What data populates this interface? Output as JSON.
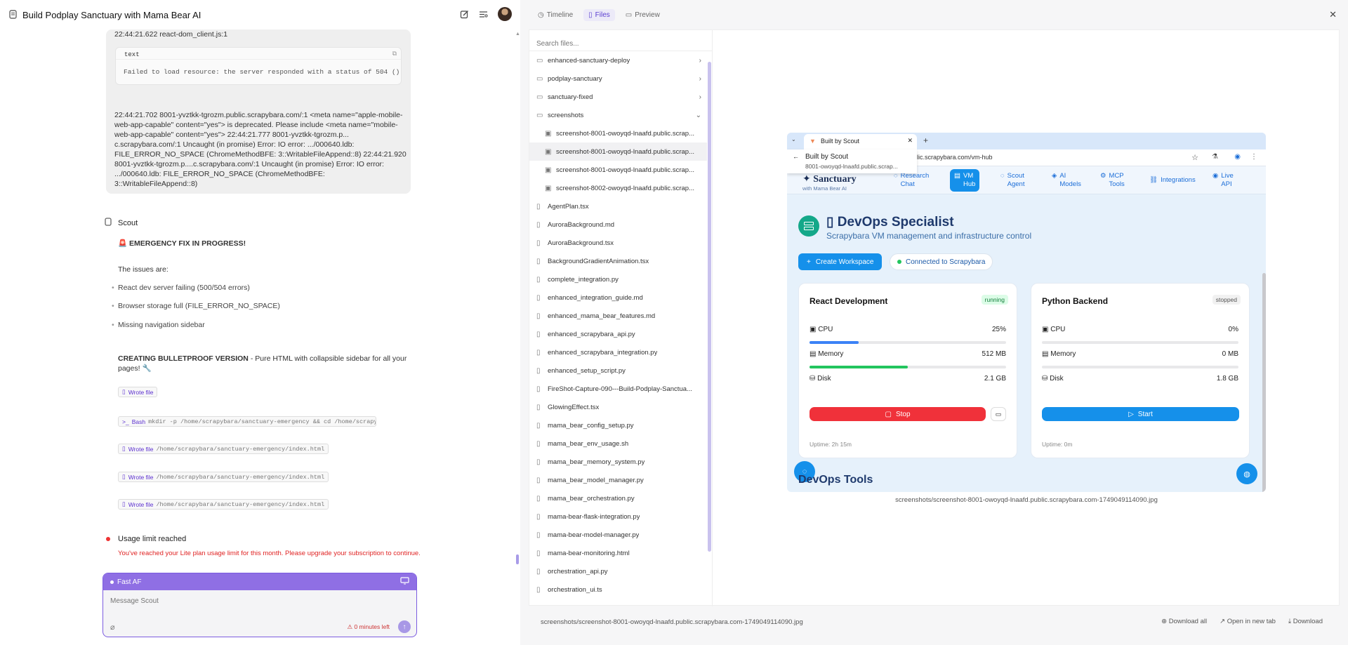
{
  "header": {
    "title": "Build Podplay Sanctuary with Mama Bear AI"
  },
  "chat": {
    "log_top": "22:44:21.622 react-dom_client.js:1",
    "code_lang": "text",
    "code_text": "Failed to load resource: the server responded with a status of 504 ()",
    "log_lines": [
      "22:44:21.702 8001-yvztkk-tgrozm.public.scrapybara.com/:1 <meta name=\"apple-mobile-",
      "web-app-capable\" content=\"yes\"> is deprecated. Please include <meta name=\"mobile-",
      "web-app-capable\" content=\"yes\"> 22:44:21.777 8001-yvztkk-tgrozm.p...",
      "c.scrapybara.com/:1 Uncaught (in promise) Error: IO error: .../000640.ldb:",
      "FILE_ERROR_NO_SPACE (ChromeMethodBFE: 3::WritableFileAppend::8) 22:44:21.920",
      "8001-yvztkk-tgrozm.p....c.scrapybara.com/:1 Uncaught (in promise) Error: IO error:",
      ".../000640.ldb: FILE_ERROR_NO_SPACE (ChromeMethodBFE: 3::WritableFileAppend::8)"
    ],
    "agent_name": "Scout",
    "emergency": "🚨 EMERGENCY FIX IN PROGRESS!",
    "issues_intro": "The issues are:",
    "issues": [
      "React dev server failing (500/504 errors)",
      "Browser storage full (FILE_ERROR_NO_SPACE)",
      "Missing navigation sidebar"
    ],
    "bulletproof_bold": "CREATING BULLETPROOF VERSION",
    "bulletproof_rest": " - Pure HTML with collapsible sidebar for all your",
    "bulletproof_line2": "pages! 🔧",
    "tools": [
      {
        "label": "Wrote file",
        "arg": ""
      },
      {
        "label": "Bash",
        "arg": "mkdir -p /home/scrapybara/sanctuary-emergency && cd /home/scrapyba..."
      },
      {
        "label": "Wrote file",
        "arg": "/home/scrapybara/sanctuary-emergency/index.html"
      },
      {
        "label": "Wrote file",
        "arg": "/home/scrapybara/sanctuary-emergency/index.html"
      },
      {
        "label": "Wrote file",
        "arg": "/home/scrapybara/sanctuary-emergency/index.html"
      }
    ],
    "usage_title": "Usage limit reached",
    "usage_msg": "You've reached your Lite plan usage limit for this month. Please upgrade your subscription to continue."
  },
  "composer": {
    "mode": "Fast AF",
    "placeholder": "Message Scout",
    "time_left": "0 minutes left"
  },
  "tabs": [
    "Timeline",
    "Files",
    "Preview"
  ],
  "files": {
    "search_placeholder": "Search files...",
    "items": [
      {
        "name": "enhanced-sanctuary-deploy",
        "type": "folder",
        "state": "collapsed"
      },
      {
        "name": "podplay-sanctuary",
        "type": "folder",
        "state": "collapsed"
      },
      {
        "name": "sanctuary-fixed",
        "type": "folder",
        "state": "collapsed"
      },
      {
        "name": "screenshots",
        "type": "folder",
        "state": "open"
      },
      {
        "name": "screenshot-8001-owoyqd-lnaafd.public.scrap...",
        "type": "image",
        "sub": true
      },
      {
        "name": "screenshot-8001-owoyqd-lnaafd.public.scrap...",
        "type": "image",
        "sub": true,
        "selected": true
      },
      {
        "name": "screenshot-8001-owoyqd-lnaafd.public.scrap...",
        "type": "image",
        "sub": true
      },
      {
        "name": "screenshot-8002-owoyqd-lnaafd.public.scrap...",
        "type": "image",
        "sub": true
      },
      {
        "name": "AgentPlan.tsx",
        "type": "file"
      },
      {
        "name": "AuroraBackground.md",
        "type": "file"
      },
      {
        "name": "AuroraBackground.tsx",
        "type": "file"
      },
      {
        "name": "BackgroundGradientAnimation.tsx",
        "type": "file"
      },
      {
        "name": "complete_integration.py",
        "type": "file"
      },
      {
        "name": "enhanced_integration_guide.md",
        "type": "file"
      },
      {
        "name": "enhanced_mama_bear_features.md",
        "type": "file"
      },
      {
        "name": "enhanced_scrapybara_api.py",
        "type": "file"
      },
      {
        "name": "enhanced_scrapybara_integration.py",
        "type": "file"
      },
      {
        "name": "enhanced_setup_script.py",
        "type": "file"
      },
      {
        "name": "FireShot-Capture-090---Build-Podplay-Sanctua...",
        "type": "file"
      },
      {
        "name": "GlowingEffect.tsx",
        "type": "file"
      },
      {
        "name": "mama_bear_config_setup.py",
        "type": "file"
      },
      {
        "name": "mama_bear_env_usage.sh",
        "type": "file"
      },
      {
        "name": "mama_bear_memory_system.py",
        "type": "file"
      },
      {
        "name": "mama_bear_model_manager.py",
        "type": "file"
      },
      {
        "name": "mama_bear_orchestration.py",
        "type": "file"
      },
      {
        "name": "mama-bear-flask-integration.py",
        "type": "file"
      },
      {
        "name": "mama-bear-model-manager.py",
        "type": "file"
      },
      {
        "name": "mama-bear-monitoring.html",
        "type": "file"
      },
      {
        "name": "orchestration_api.py",
        "type": "file"
      },
      {
        "name": "orchestration_ui.ts",
        "type": "file"
      }
    ]
  },
  "preview": {
    "browser_tab": "Built by Scout",
    "tooltip_title": "Built by Scout",
    "tooltip_url": "8001-owoyqd-lnaafd.public.scrap...",
    "url": "afd.public.scrapybara.com/vm-hub",
    "app_logo": "Sanctuary",
    "app_logo_sub": "with Mama Bear AI",
    "nav": [
      "Research\nChat",
      "VM\nHub",
      "Scout\nAgent",
      "AI\nModels",
      "MCP\nTools",
      "Integrations",
      "Live\nAPI"
    ],
    "title": "▯ DevOps Specialist",
    "subtitle": "Scrapybara VM management and infrastructure control",
    "create_btn": "Create Workspace",
    "connected": "Connected to Scrapybara",
    "cards": [
      {
        "name": "React Development",
        "status": "running",
        "cpu": "25%",
        "cpu_frac": 0.25,
        "memory": "512 MB",
        "mem_frac": 0.5,
        "disk": "2.1 GB",
        "action": "Stop",
        "uptime": "Uptime: 2h 15m"
      },
      {
        "name": "Python Backend",
        "status": "stopped",
        "cpu": "0%",
        "cpu_frac": 0,
        "memory": "0 MB",
        "mem_frac": 0,
        "disk": "1.8 GB",
        "action": "Start",
        "uptime": "Uptime: 0m"
      }
    ],
    "labels": {
      "cpu": "CPU",
      "memory": "Memory",
      "disk": "Disk"
    },
    "section": "DevOps Tools",
    "caption": "screenshots/screenshot-8001-owoyqd-lnaafd.public.scrapybara.com-1749049114090.jpg",
    "colors": {
      "accent": "#1590ea",
      "stop": "#f0313a",
      "running": "#16a34a",
      "brand": "#5b3fd0"
    }
  },
  "footer": {
    "path": "screenshots/screenshot-8001-owoyqd-lnaafd.public.scrapybara.com-1749049114090.jpg",
    "download_all": "Download all",
    "open_new": "Open in new tab",
    "download": "Download"
  }
}
